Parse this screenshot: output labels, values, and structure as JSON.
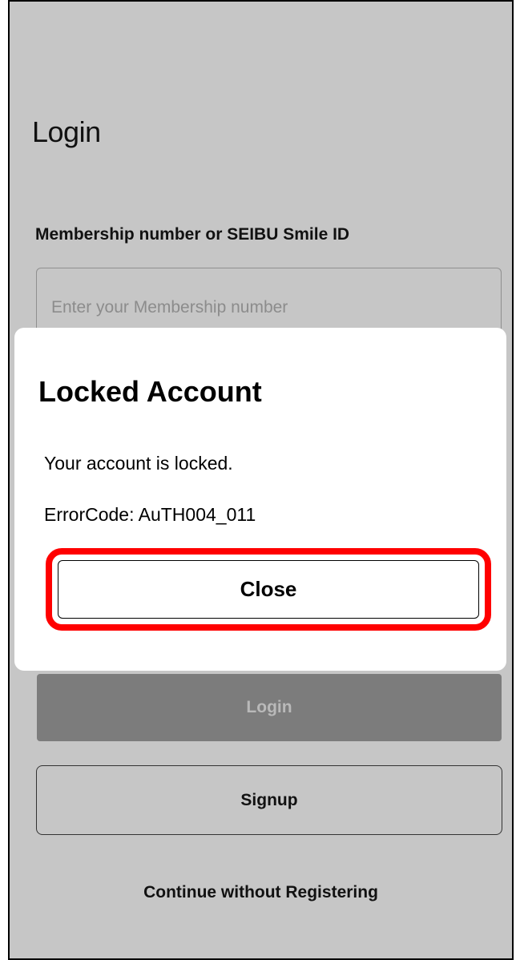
{
  "login_screen": {
    "title": "Login",
    "field_label": "Membership number or SEIBU Smile ID",
    "membership_input": {
      "value": "",
      "placeholder": "Enter your Membership number"
    },
    "login_button_label": "Login",
    "signup_button_label": "Signup",
    "continue_link_label": "Continue without Registering"
  },
  "dialog": {
    "title": "Locked Account",
    "message": "Your account is locked.",
    "error_code": "ErrorCode: AuTH004_011",
    "close_button_label": "Close"
  },
  "colors": {
    "screen_background": "#c6c6c6",
    "dialog_background": "#ffffff",
    "disabled_button": "#7c7c7c",
    "highlight_outline": "#ff0000"
  }
}
